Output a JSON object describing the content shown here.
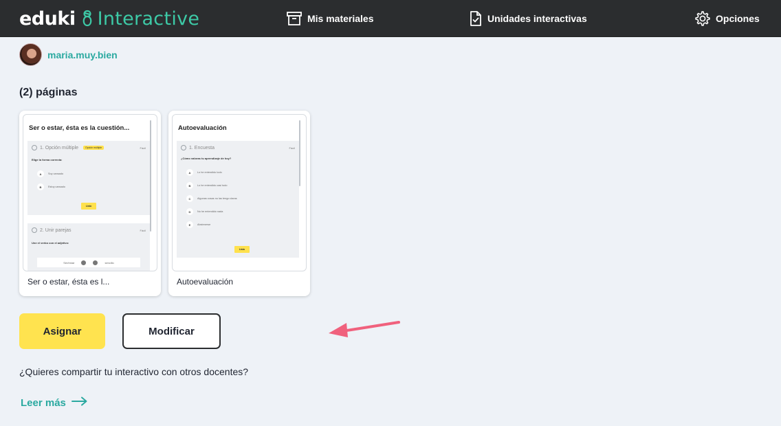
{
  "header": {
    "logo_brand": "eduki",
    "logo_product": "Interactive",
    "nav": {
      "materiales": "Mis materiales",
      "unidades": "Unidades interactivas",
      "opciones": "Opciones"
    }
  },
  "user": {
    "name": "maria.muy.bien"
  },
  "pages": {
    "count_label": "(2) páginas",
    "cards": [
      {
        "label": "Ser o estar, ésta es l...",
        "preview": {
          "title": "Ser o estar, ésta es la cuestión...",
          "q1_title": "1. Opción múltiple",
          "q1_badge": "Opción múltiple",
          "q1_tag": "Fácil",
          "q1_prompt": "Elige la forma correcta:",
          "q1_options": [
            {
              "letter": "A",
              "text": "Soy cansado"
            },
            {
              "letter": "B",
              "text": "Estoy cansado"
            }
          ],
          "q1_button": "Listo",
          "q2_title": "2. Unir parejas",
          "q2_tag": "Fácil",
          "q2_prompt": "Une el verbo con el adjetivo:",
          "q2_left": "Ser/estar",
          "q2_right": "sencillo"
        }
      },
      {
        "label": "Autoevaluación",
        "preview": {
          "title": "Autoevaluación",
          "q1_title": "1. Encuesta",
          "q1_tag": "Fácil",
          "q1_prompt": "¿Cómo valoras tu aprendizaje de hoy?",
          "q1_options": [
            {
              "letter": "A",
              "text": "Lo he entendido todo"
            },
            {
              "letter": "B",
              "text": "Lo he entendido casi todo"
            },
            {
              "letter": "C",
              "text": "Algunas cosas no las tengo claras"
            },
            {
              "letter": "D",
              "text": "No he entendido nada"
            },
            {
              "letter": "E",
              "text": "Abstenerse"
            }
          ],
          "q1_button": "Listo"
        }
      }
    ]
  },
  "actions": {
    "assign": "Asignar",
    "modify": "Modificar"
  },
  "share": {
    "question": "¿Quieres compartir tu interactivo con otros docentes?",
    "read_more": "Leer más"
  },
  "colors": {
    "header_bg": "#2b2d2f",
    "brand_teal": "#3dc9a6",
    "accent_yellow": "#ffe34f",
    "arrow_pink": "#f0617d"
  }
}
